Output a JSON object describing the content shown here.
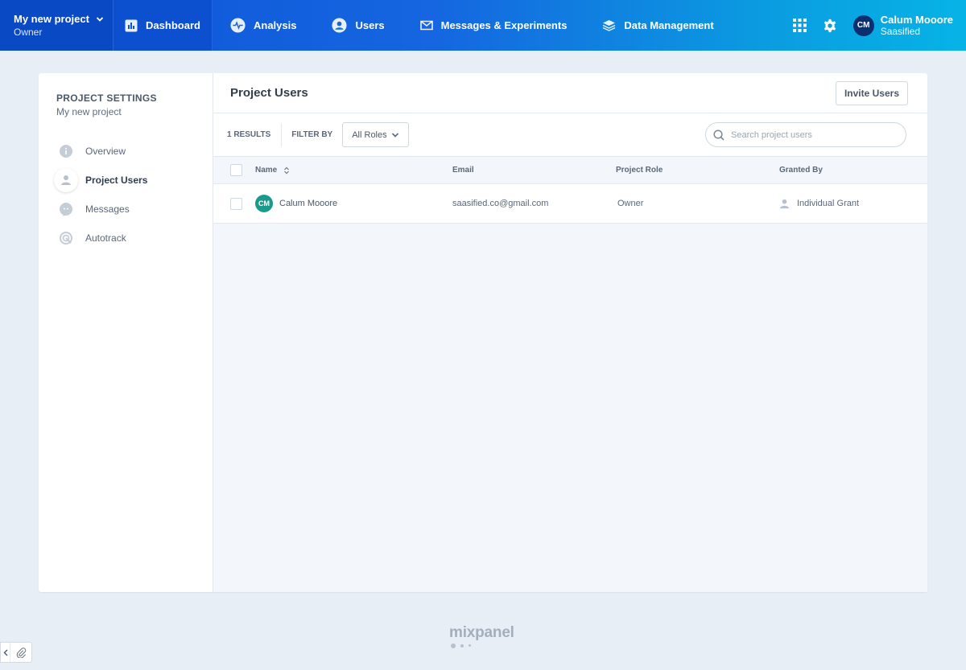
{
  "topbar": {
    "project_name": "My new project",
    "project_role": "Owner",
    "dashboard_label": "Dashboard",
    "nav": [
      {
        "label": "Analysis",
        "icon": "pulse-icon"
      },
      {
        "label": "Users",
        "icon": "user-circle-icon"
      },
      {
        "label": "Messages & Experiments",
        "icon": "envelope-icon"
      },
      {
        "label": "Data Management",
        "icon": "layers-icon"
      }
    ],
    "user_initials": "CM",
    "user_name": "Calum Mooore",
    "user_org": "Saasified"
  },
  "sidebar": {
    "title": "PROJECT SETTINGS",
    "subtitle": "My new project",
    "items": [
      {
        "label": "Overview",
        "icon": "info-icon",
        "active": false
      },
      {
        "label": "Project Users",
        "icon": "person-icon",
        "active": true
      },
      {
        "label": "Messages",
        "icon": "chat-icon",
        "active": false
      },
      {
        "label": "Autotrack",
        "icon": "target-icon",
        "active": false
      }
    ]
  },
  "main": {
    "title": "Project Users",
    "invite_label": "Invite Users",
    "results_label": "1 RESULTS",
    "filter_label": "FILTER BY",
    "roles_selected": "All Roles",
    "search_placeholder": "Search project users",
    "columns": [
      "Name",
      "Email",
      "Project Role",
      "Granted By"
    ],
    "rows": [
      {
        "initials": "CM",
        "name": "Calum Mooore",
        "email": "saasified.co@gmail.com",
        "role": "Owner",
        "granted_by": "Individual Grant"
      }
    ]
  },
  "footer": {
    "logo_text": "mixpanel"
  },
  "colors": {
    "nav_start": "#0d53d6",
    "nav_end": "#06b3e6",
    "row_avatar": "#1a9a8a",
    "page_bg": "#e7eef6"
  }
}
